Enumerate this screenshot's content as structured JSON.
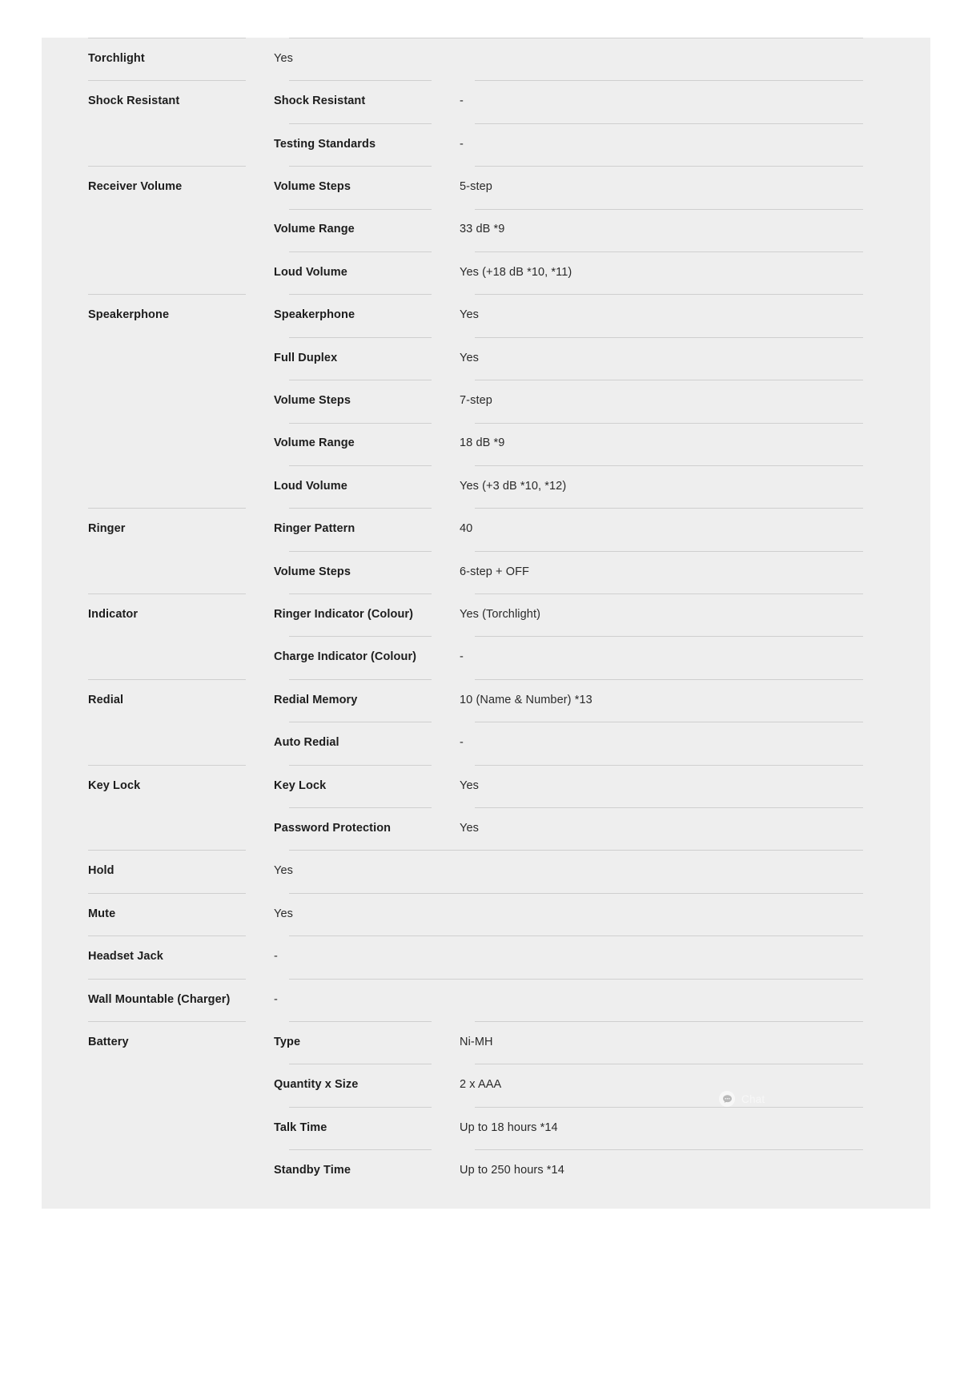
{
  "panel": {
    "background_color": "#eeeeee",
    "rule_color": "#cfcfcf"
  },
  "chat_widget": {
    "label": "Chat",
    "icon": "chat-bubble-icon",
    "color": "#ffffff"
  },
  "spec_table": {
    "groups": [
      {
        "group_label": "Torchlight",
        "merged_value": true,
        "value": "Yes",
        "rows": []
      },
      {
        "group_label": "Shock Resistant",
        "merged_value": false,
        "rows": [
          {
            "sub_label": "Shock Resistant",
            "value": "-"
          },
          {
            "sub_label": "Testing Standards",
            "value": "-"
          }
        ]
      },
      {
        "group_label": "Receiver Volume",
        "merged_value": false,
        "rows": [
          {
            "sub_label": "Volume Steps",
            "value": "5-step"
          },
          {
            "sub_label": "Volume Range",
            "value": "33 dB *9"
          },
          {
            "sub_label": "Loud Volume",
            "value": "Yes (+18 dB *10, *11)"
          }
        ]
      },
      {
        "group_label": "Speakerphone",
        "merged_value": false,
        "rows": [
          {
            "sub_label": "Speakerphone",
            "value": "Yes"
          },
          {
            "sub_label": "Full Duplex",
            "value": "Yes"
          },
          {
            "sub_label": "Volume Steps",
            "value": "7-step"
          },
          {
            "sub_label": "Volume Range",
            "value": "18 dB *9"
          },
          {
            "sub_label": "Loud Volume",
            "value": "Yes (+3 dB *10, *12)"
          }
        ]
      },
      {
        "group_label": "Ringer",
        "merged_value": false,
        "rows": [
          {
            "sub_label": "Ringer Pattern",
            "value": "40"
          },
          {
            "sub_label": "Volume Steps",
            "value": "6-step + OFF"
          }
        ]
      },
      {
        "group_label": "Indicator",
        "merged_value": false,
        "rows": [
          {
            "sub_label": "Ringer Indicator (Colour)",
            "value": "Yes (Torchlight)"
          },
          {
            "sub_label": "Charge Indicator (Colour)",
            "value": "-"
          }
        ]
      },
      {
        "group_label": "Redial",
        "merged_value": false,
        "rows": [
          {
            "sub_label": "Redial Memory",
            "value": "10 (Name & Number) *13"
          },
          {
            "sub_label": "Auto Redial",
            "value": "-"
          }
        ]
      },
      {
        "group_label": "Key Lock",
        "merged_value": false,
        "rows": [
          {
            "sub_label": "Key Lock",
            "value": "Yes"
          },
          {
            "sub_label": "Password Protection",
            "value": "Yes"
          }
        ]
      },
      {
        "group_label": "Hold",
        "merged_value": true,
        "value": "Yes",
        "rows": []
      },
      {
        "group_label": "Mute",
        "merged_value": true,
        "value": "Yes",
        "rows": []
      },
      {
        "group_label": "Headset Jack",
        "merged_value": true,
        "value": "-",
        "rows": []
      },
      {
        "group_label": "Wall Mountable (Charger)",
        "merged_value": true,
        "value": "-",
        "rows": []
      },
      {
        "group_label": "Battery",
        "merged_value": false,
        "rows": [
          {
            "sub_label": "Type",
            "value": "Ni-MH"
          },
          {
            "sub_label": "Quantity x Size",
            "value": "2 x AAA"
          },
          {
            "sub_label": "Talk Time",
            "value": "Up to 18 hours *14"
          },
          {
            "sub_label": "Standby Time",
            "value": "Up to 250 hours *14"
          }
        ]
      }
    ]
  }
}
